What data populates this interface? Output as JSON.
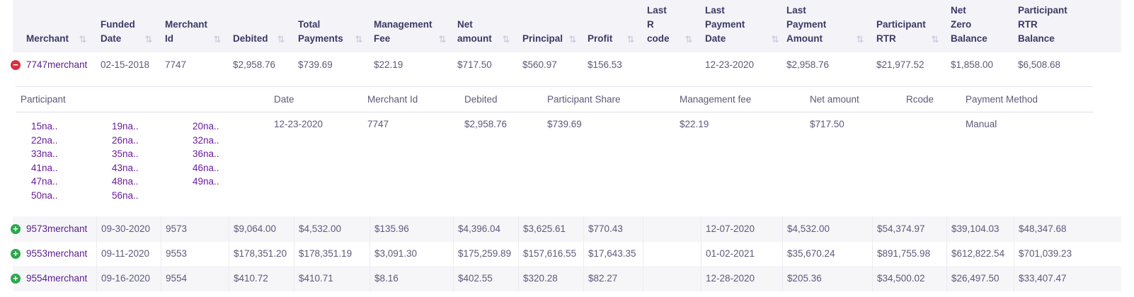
{
  "columns": [
    {
      "label_lines": [
        "Merchant"
      ],
      "sort": true
    },
    {
      "label_lines": [
        "Funded",
        "Date"
      ],
      "sort": true
    },
    {
      "label_lines": [
        "Merchant",
        "Id"
      ],
      "sort": true
    },
    {
      "label_lines": [
        "Debited"
      ],
      "sort": true
    },
    {
      "label_lines": [
        "Total",
        "Payments"
      ],
      "sort": true
    },
    {
      "label_lines": [
        "Management",
        "Fee"
      ],
      "sort": true
    },
    {
      "label_lines": [
        "Net",
        "amount"
      ],
      "sort": true
    },
    {
      "label_lines": [
        "Principal"
      ],
      "sort": true
    },
    {
      "label_lines": [
        "Profit"
      ],
      "sort": true
    },
    {
      "label_lines": [
        "Last R",
        "code"
      ],
      "sort": true
    },
    {
      "label_lines": [
        "Last",
        "Payment",
        "Date"
      ],
      "sort": true
    },
    {
      "label_lines": [
        "Last Payment",
        "Amount"
      ],
      "sort": true
    },
    {
      "label_lines": [
        "Participant",
        "RTR"
      ],
      "sort": true
    },
    {
      "label_lines": [
        "Net Zero",
        "Balance"
      ],
      "sort": false
    },
    {
      "label_lines": [
        "Participant RTR",
        "Balance"
      ],
      "sort": false
    }
  ],
  "sort_glyph": "⇅",
  "expanded_row": {
    "merchant": "7747merchant",
    "funded_date": "02-15-2018",
    "merchant_id": "7747",
    "debited": "$2,958.76",
    "total_payments": "$739.69",
    "management_fee": "$22.19",
    "net_amount": "$717.50",
    "principal": "$560.97",
    "profit": "$156.53",
    "last_rcode": "",
    "last_payment_date": "12-23-2020",
    "last_payment_amount": "$2,958.76",
    "participant_rtr": "$21,977.52",
    "net_zero_balance": "$1,858.00",
    "participant_rtr_balance": "$6,508.68"
  },
  "detail": {
    "headers": {
      "participant": "Participant",
      "date": "Date",
      "merchant_id": "Merchant Id",
      "debited": "Debited",
      "participant_share": "Participant Share",
      "management_fee": "Management fee",
      "net_amount": "Net amount",
      "rcode": "Rcode",
      "payment_method": "Payment Method"
    },
    "participants": [
      "15na..",
      "19na..",
      "20na..",
      "22na..",
      "26na..",
      "32na..",
      "33na..",
      "35na..",
      "36na..",
      "41na..",
      "43na..",
      "46na..",
      "47na..",
      "48na..",
      "49na..",
      "50na..",
      "56na.."
    ],
    "values": {
      "date": "12-23-2020",
      "merchant_id": "7747",
      "debited": "$2,958.76",
      "participant_share": "$739.69",
      "management_fee": "$22.19",
      "net_amount": "$717.50",
      "rcode": "",
      "payment_method": "Manual"
    }
  },
  "rows": [
    {
      "merchant": "9573merchant",
      "funded_date": "09-30-2020",
      "merchant_id": "9573",
      "debited": "$9,064.00",
      "total_payments": "$4,532.00",
      "management_fee": "$135.96",
      "net_amount": "$4,396.04",
      "principal": "$3,625.61",
      "profit": "$770.43",
      "last_rcode": "",
      "last_payment_date": "12-07-2020",
      "last_payment_amount": "$4,532.00",
      "participant_rtr": "$54,374.97",
      "net_zero_balance": "$39,104.03",
      "participant_rtr_balance": "$48,347.68"
    },
    {
      "merchant": "9553merchant",
      "funded_date": "09-11-2020",
      "merchant_id": "9553",
      "debited": "$178,351.20",
      "total_payments": "$178,351.19",
      "management_fee": "$3,091.30",
      "net_amount": "$175,259.89",
      "principal": "$157,616.55",
      "profit": "$17,643.35",
      "last_rcode": "",
      "last_payment_date": "01-02-2021",
      "last_payment_amount": "$35,670.24",
      "participant_rtr": "$891,755.98",
      "net_zero_balance": "$612,822.54",
      "participant_rtr_balance": "$701,039.23"
    },
    {
      "merchant": "9554merchant",
      "funded_date": "09-16-2020",
      "merchant_id": "9554",
      "debited": "$410.72",
      "total_payments": "$410.71",
      "management_fee": "$8.16",
      "net_amount": "$402.55",
      "principal": "$320.28",
      "profit": "$82.27",
      "last_rcode": "",
      "last_payment_date": "12-28-2020",
      "last_payment_amount": "$205.36",
      "participant_rtr": "$34,500.02",
      "net_zero_balance": "$26,497.50",
      "participant_rtr_balance": "$33,407.47"
    }
  ]
}
